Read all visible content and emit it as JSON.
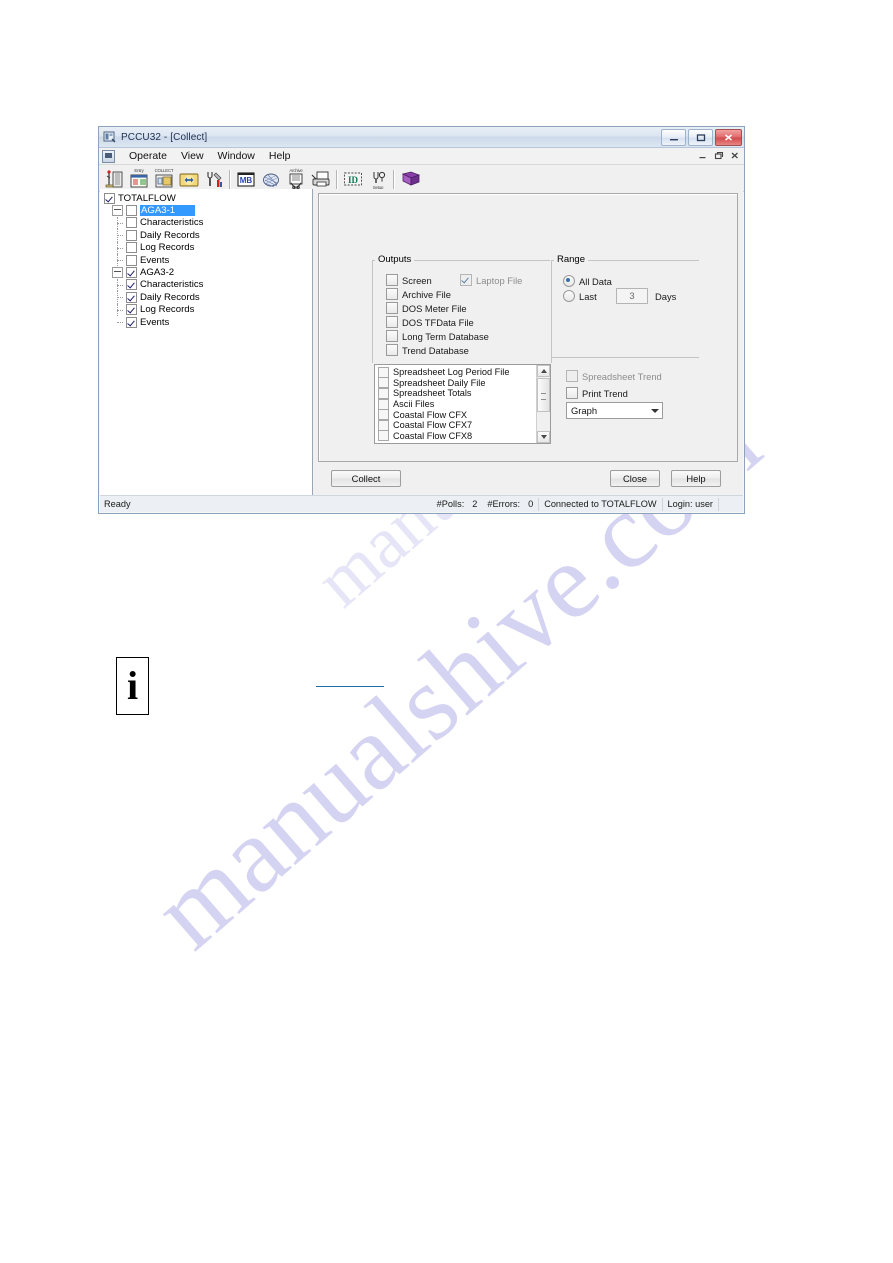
{
  "window": {
    "title": "PCCU32 - [Collect]",
    "app_icon": "pccu-app-icon",
    "controls": {
      "minimize": "–",
      "maximize": "❐",
      "close": "✕"
    },
    "mdi_controls": {
      "minimize": "_",
      "restore": "❐",
      "close": "✕"
    }
  },
  "menubar": {
    "items": [
      {
        "label": "Operate"
      },
      {
        "label": "View"
      },
      {
        "label": "Window"
      },
      {
        "label": "Help"
      }
    ]
  },
  "toolbar": {
    "buttons": [
      {
        "name": "terminal-icon",
        "label": ""
      },
      {
        "name": "entry-icon",
        "label": "Entry"
      },
      {
        "name": "collect-icon",
        "label": "COLLECT"
      },
      {
        "name": "transfer-icon",
        "label": ""
      },
      {
        "name": "calibrate-icon",
        "label": ""
      },
      {
        "name": "modbus-icon",
        "label": ""
      },
      {
        "name": "analysis-icon",
        "label": ""
      },
      {
        "name": "archive-icon",
        "label": "Archive"
      },
      {
        "name": "print-icon",
        "label": ""
      },
      {
        "name": "id-icon",
        "label": "ID"
      },
      {
        "name": "setup-icon",
        "label": "Setup"
      },
      {
        "name": "help-book-icon",
        "label": ""
      }
    ]
  },
  "tree": {
    "nodes": [
      {
        "label": "TOTALFLOW",
        "level": 0,
        "checked": true,
        "expander": false,
        "selected": false
      },
      {
        "label": "AGA3-1",
        "level": 1,
        "checked": false,
        "expander": true,
        "selected": true
      },
      {
        "label": "Characteristics",
        "level": 2,
        "checked": false,
        "expander": false,
        "selected": false
      },
      {
        "label": "Daily Records",
        "level": 2,
        "checked": false,
        "expander": false,
        "selected": false
      },
      {
        "label": "Log Records",
        "level": 2,
        "checked": false,
        "expander": false,
        "selected": false
      },
      {
        "label": "Events",
        "level": 2,
        "checked": false,
        "expander": false,
        "selected": false
      },
      {
        "label": "AGA3-2",
        "level": 1,
        "checked": true,
        "expander": true,
        "selected": false
      },
      {
        "label": "Characteristics",
        "level": 2,
        "checked": true,
        "expander": false,
        "selected": false
      },
      {
        "label": "Daily Records",
        "level": 2,
        "checked": true,
        "expander": false,
        "selected": false
      },
      {
        "label": "Log Records",
        "level": 2,
        "checked": true,
        "expander": false,
        "selected": false
      },
      {
        "label": "Events",
        "level": 2,
        "checked": true,
        "expander": false,
        "selected": false
      }
    ]
  },
  "dialog": {
    "outputs": {
      "title": "Outputs",
      "items": [
        {
          "label": "Screen",
          "checked": false,
          "disabled": false
        },
        {
          "label": "Archive File",
          "checked": false,
          "disabled": false
        },
        {
          "label": "DOS Meter File",
          "checked": false,
          "disabled": false
        },
        {
          "label": "DOS TFData File",
          "checked": false,
          "disabled": false
        },
        {
          "label": "Long Term Database",
          "checked": false,
          "disabled": false
        },
        {
          "label": "Trend Database",
          "checked": false,
          "disabled": false
        }
      ],
      "laptop_file": {
        "label": "Laptop File",
        "checked": true,
        "disabled": true
      }
    },
    "range": {
      "title": "Range",
      "all_data": {
        "label": "All Data",
        "selected": true
      },
      "last": {
        "label": "Last",
        "selected": false
      },
      "days_value": "3",
      "days_unit": "Days"
    },
    "file_list": {
      "items": [
        {
          "label": "Spreadsheet Log Period File",
          "checked": false
        },
        {
          "label": "Spreadsheet Daily File",
          "checked": false
        },
        {
          "label": "Spreadsheet Totals",
          "checked": false
        },
        {
          "label": "Ascii Files",
          "checked": false
        },
        {
          "label": "Coastal Flow CFX",
          "checked": false
        },
        {
          "label": "Coastal Flow CFX7",
          "checked": false
        },
        {
          "label": "Coastal Flow CFX8",
          "checked": false
        }
      ]
    },
    "trend": {
      "spreadsheet_trend": {
        "label": "Spreadsheet Trend",
        "checked": false,
        "disabled": true
      },
      "print_trend": {
        "label": "Print Trend",
        "checked": false,
        "disabled": false
      },
      "mode_select": {
        "value": "Graph"
      }
    },
    "buttons": {
      "collect": "Collect",
      "close": "Close",
      "help": "Help"
    }
  },
  "statusbar": {
    "ready": "Ready",
    "polls_label": "#Polls:",
    "polls_value": "2",
    "errors_label": "#Errors:",
    "errors_value": "0",
    "connection": "Connected to TOTALFLOW",
    "login": "Login: user"
  },
  "page_note": {
    "icon_glyph": "i"
  },
  "watermark": {
    "line1": "manualshive.com",
    "line2": "manualshive.com"
  },
  "colors": {
    "selection": "#3399ff",
    "accent": "#3a6ea5",
    "watermark": "#cdcdf0",
    "link": "#1f6fa5"
  }
}
